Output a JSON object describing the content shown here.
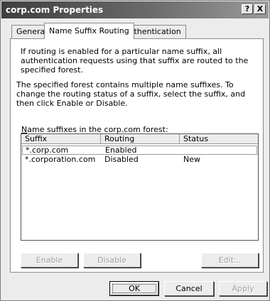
{
  "window": {
    "title": "corp.com Properties",
    "help_label": "?",
    "close_label": "X"
  },
  "tabs": [
    {
      "label": "General",
      "active": false
    },
    {
      "label": "Name Suffix Routing",
      "active": true
    },
    {
      "label": "Authentication",
      "active": false
    }
  ],
  "panel": {
    "intro_text": "If routing is enabled for a particular name suffix, all authentication requests using that suffix are routed to the specified forest.",
    "instructions_text": "The specified forest contains multiple name suffixes. To change the routing status of a suffix, select the suffix, and then click Enable or Disable.",
    "list_label_mnemonic": "N",
    "list_label_rest": "ame suffixes in the corp.com forest:"
  },
  "suffix_list": {
    "columns": [
      "Suffix",
      "Routing",
      "Status"
    ],
    "rows": [
      {
        "suffix": "*.corp.com",
        "routing": "Enabled",
        "status": "",
        "selected": true
      },
      {
        "suffix": "*.corporation.com",
        "routing": "Disabled",
        "status": "New",
        "selected": false
      }
    ]
  },
  "panel_buttons": {
    "enable_label": "Enable",
    "disable_label": "Disable",
    "edit_label": "Edit..."
  },
  "dialog_buttons": {
    "ok_label": "OK",
    "cancel_label": "Cancel",
    "apply_label": "Apply"
  }
}
